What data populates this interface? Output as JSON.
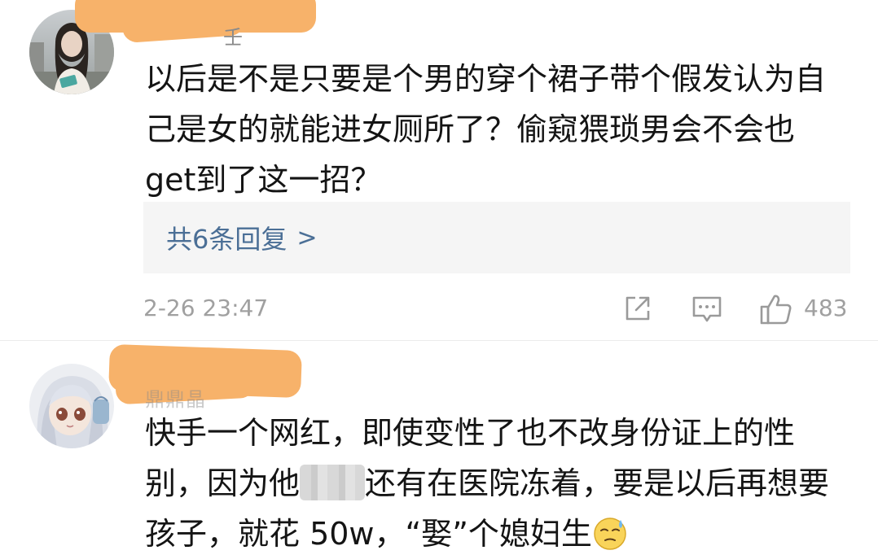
{
  "comments": [
    {
      "name_remnant": "壬",
      "text": "以后是不是只要是个男的穿个裙子带个假发认为自\n己是女的就能进女厕所了？偷窥猥琐男会不会也\nget到了这一招？",
      "replies_label": "共6条回复",
      "replies_chevron": ">",
      "timestamp": "2-26 23:47",
      "like_count": "483"
    },
    {
      "name_remnant": "鼎鼎晶",
      "text_part_1": "快手一个网红，即使变性了也不改身份证上的性\n别，因为他",
      "text_part_2": "还有在医院冻着，要是以后再想要\n孩子，就花 50w，“娶”个媳妇生"
    }
  ],
  "icons": {
    "share": "share-icon",
    "comment": "comment-icon",
    "like": "thumbs-up-icon",
    "emoji": "cold-sweat-emoji-icon"
  },
  "colors": {
    "text": "#141414",
    "link": "#4b6f96",
    "muted": "#a0a0a0",
    "redaction": "#f7b26a",
    "reply_box_bg": "#f5f5f5"
  }
}
